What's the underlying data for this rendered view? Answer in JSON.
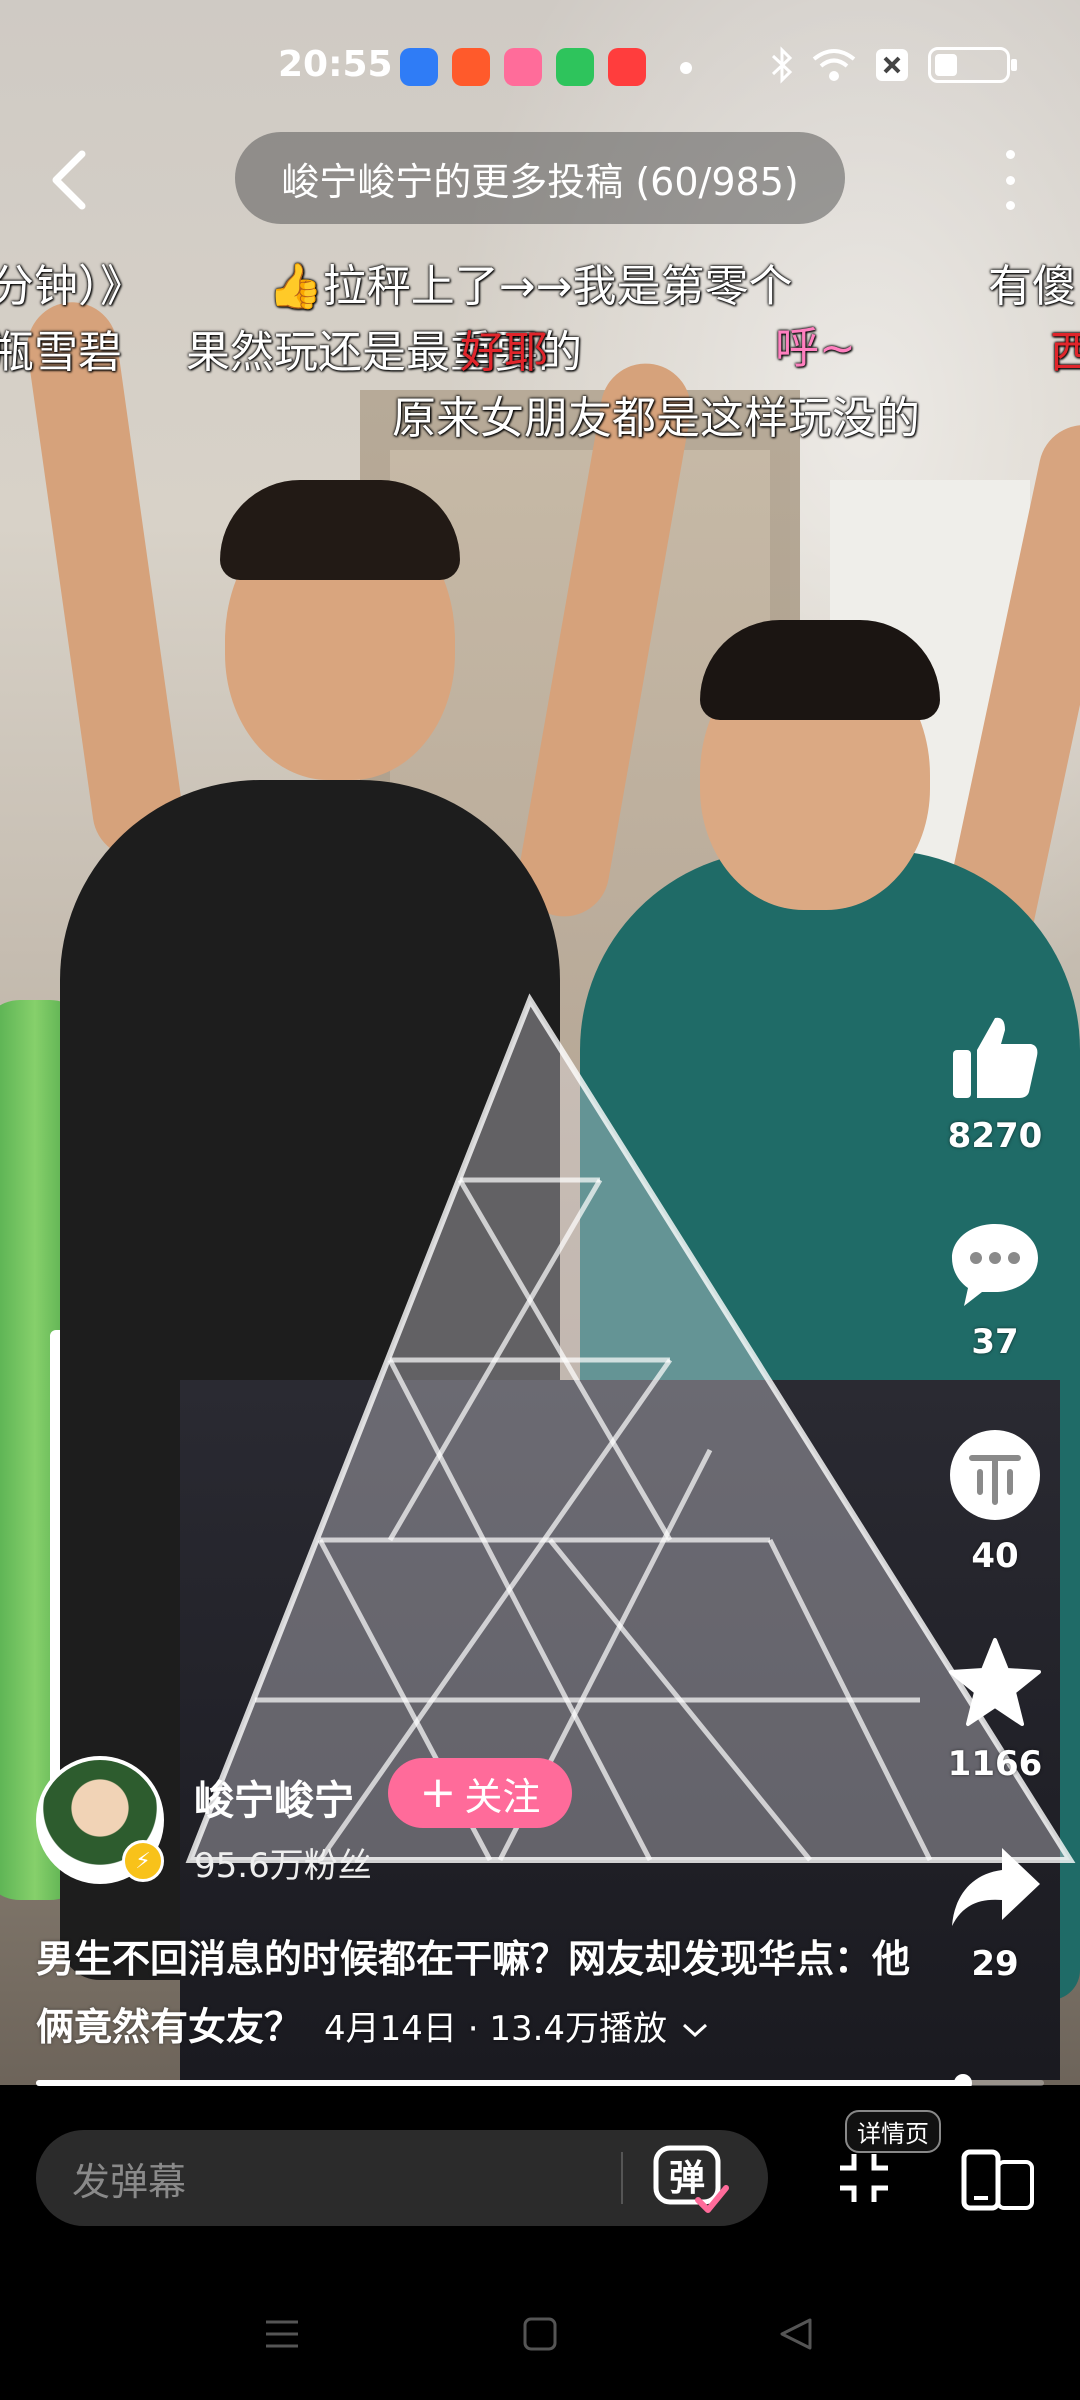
{
  "status_bar": {
    "time": "20:55",
    "app_icons": [
      "qq-browser-icon",
      "kuaishou-icon",
      "bilibili-icon",
      "shop-icon",
      "music-icon"
    ],
    "app_icon_colors": [
      "#2f7cf6",
      "#ff5a2b",
      "#ff6c9a",
      "#2ec45c",
      "#ff3d3d"
    ]
  },
  "top_bar": {
    "title": "峻宁峻宁的更多投稿 (60/985)"
  },
  "danmaku": [
    {
      "text": "分钟）》",
      "color": "#ffffff"
    },
    {
      "text": "拉秤上了→→我是第零个",
      "color": "#ffffff"
    },
    {
      "text": "有傻",
      "color": "#ffffff"
    },
    {
      "text": "瓶雪碧",
      "color": "#ffffff"
    },
    {
      "text": "果然玩还是最重要的",
      "color": "#ffffff"
    },
    {
      "text": "好耶",
      "color": "#e0252b"
    },
    {
      "text": "呼~",
      "color": "#ff7fbf"
    },
    {
      "text": "西",
      "color": "#e0252b"
    },
    {
      "text": "原来女朋友都是这样玩没的",
      "color": "#ffffff"
    }
  ],
  "actions": {
    "like_count": "8270",
    "comment_count": "37",
    "coin_count": "40",
    "favorite_count": "1166",
    "share_count": "29"
  },
  "uploader": {
    "name": "峻宁峻宁",
    "fans": "95.6万粉丝",
    "follow_label": "关注"
  },
  "video": {
    "description": "男生不回消息的时候都在干嘛？网友却发现华点：他俩竟然有女友？",
    "meta": "4月14日 · 13.4万播放",
    "progress": 0.92
  },
  "bottom_bar": {
    "danmaku_placeholder": "发弹幕",
    "danmaku_toggle_label": "弹",
    "detail_label": "详情页"
  },
  "colors": {
    "follow_button": "#ff6b9a",
    "accent_pink": "#ff6b9a"
  }
}
